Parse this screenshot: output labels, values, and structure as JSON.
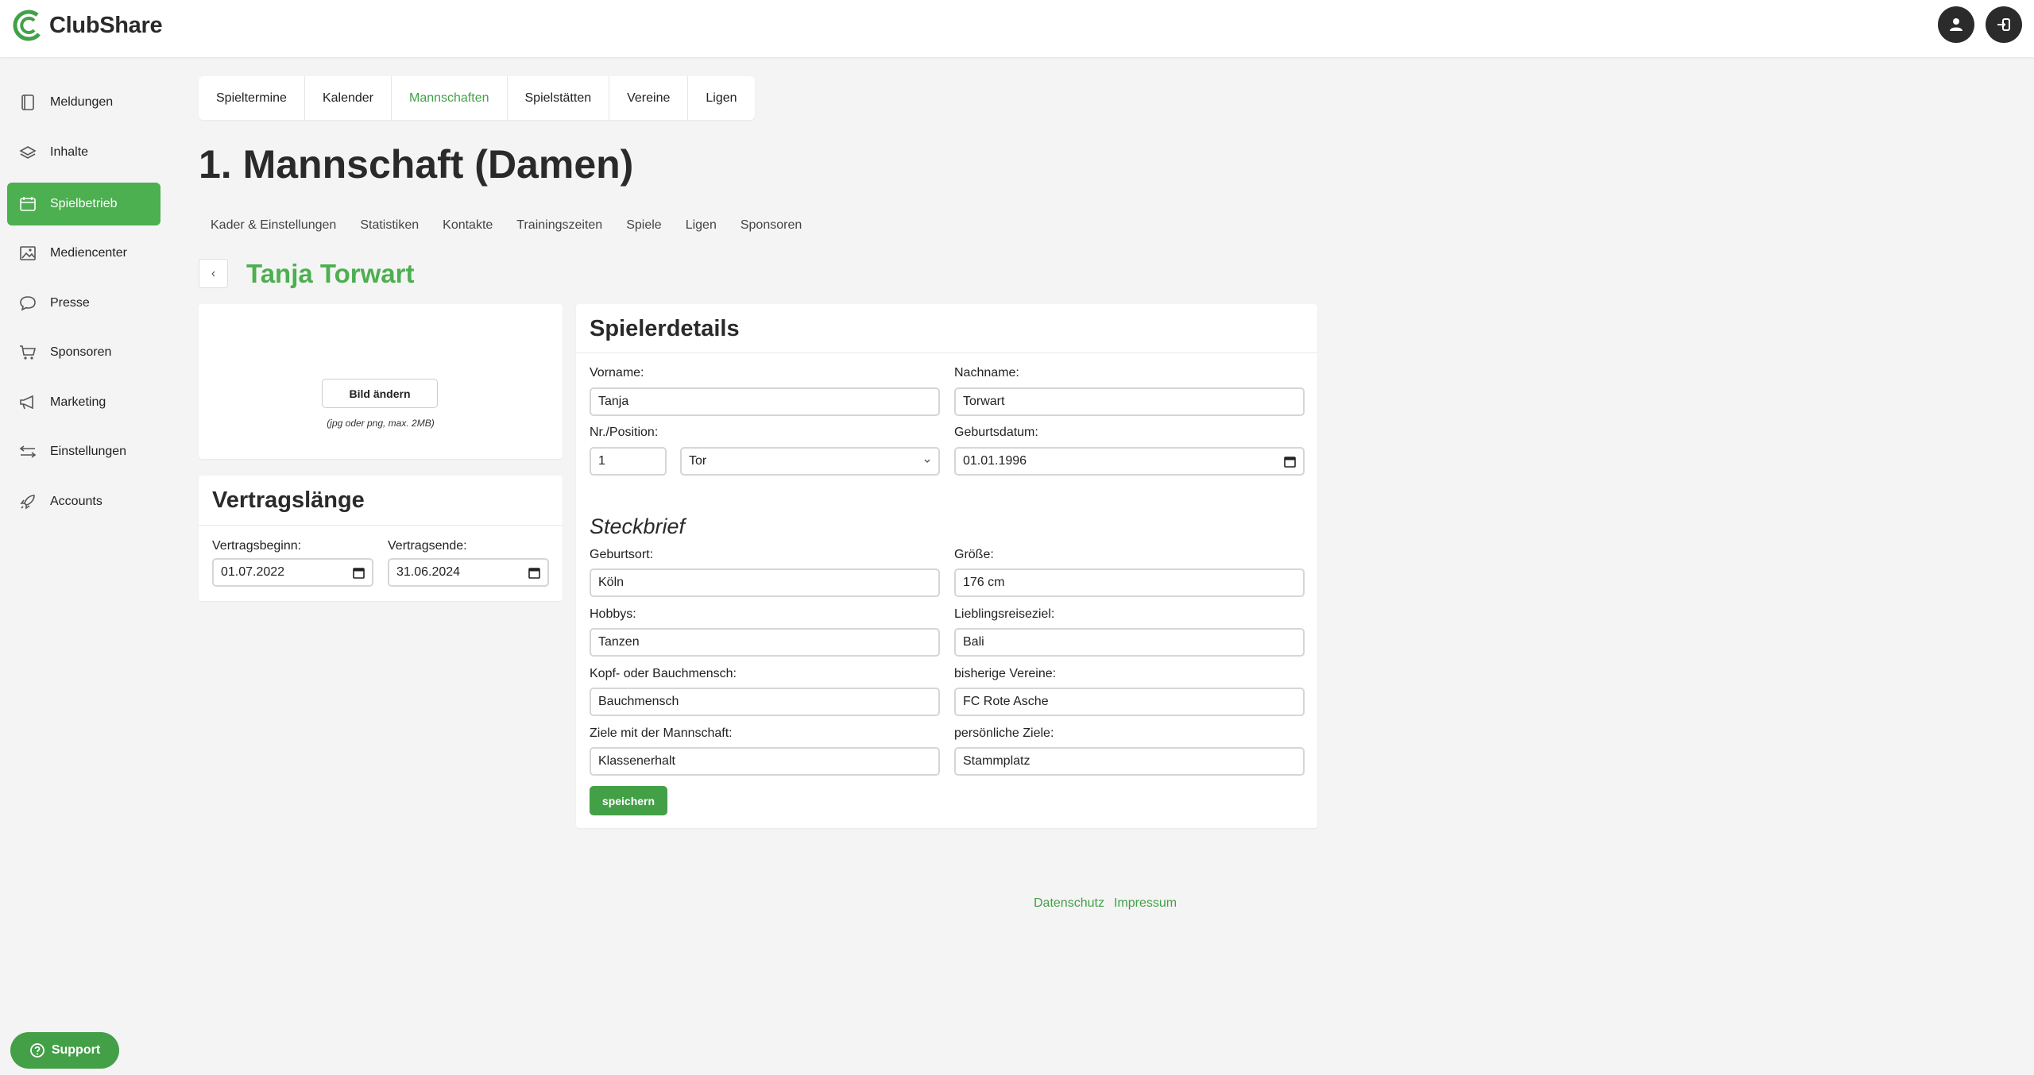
{
  "header": {
    "brand": "ClubShare"
  },
  "sidebar": {
    "items": [
      {
        "label": "Meldungen",
        "icon": "book-icon"
      },
      {
        "label": "Inhalte",
        "icon": "layers-icon"
      },
      {
        "label": "Spielbetrieb",
        "icon": "calendar-icon",
        "active": true
      },
      {
        "label": "Mediencenter",
        "icon": "image-icon"
      },
      {
        "label": "Presse",
        "icon": "chat-bubble-icon"
      },
      {
        "label": "Sponsoren",
        "icon": "cart-icon"
      },
      {
        "label": "Marketing",
        "icon": "megaphone-icon"
      },
      {
        "label": "Einstellungen",
        "icon": "sliders-icon"
      },
      {
        "label": "Accounts",
        "icon": "rocket-icon"
      }
    ],
    "support": "Support"
  },
  "tabs": [
    "Spieltermine",
    "Kalender",
    "Mannschaften",
    "Spielstätten",
    "Vereine",
    "Ligen"
  ],
  "active_tab": "Mannschaften",
  "page_title": "1. Mannschaft (Damen)",
  "subtabs": [
    "Kader & Einstellungen",
    "Statistiken",
    "Kontakte",
    "Trainingszeiten",
    "Spiele",
    "Ligen",
    "Sponsoren"
  ],
  "player_name": "Tanja Torwart",
  "image_card": {
    "button": "Bild ändern",
    "hint": "(jpg oder png, max. 2MB)"
  },
  "contract": {
    "title": "Vertragslänge",
    "start_label": "Vertragsbeginn:",
    "start_value": "01.07.2022",
    "end_label": "Vertragsende:",
    "end_value": "31.06.2024"
  },
  "details": {
    "title": "Spielerdetails",
    "vorname_label": "Vorname:",
    "vorname": "Tanja",
    "nachname_label": "Nachname:",
    "nachname": "Torwart",
    "nrpos_label": "Nr./Position:",
    "nr": "1",
    "position": "Tor",
    "geburtsdatum_label": "Geburtsdatum:",
    "geburtsdatum": "01.01.1996",
    "steckbrief_title": "Steckbrief",
    "geburtsort_label": "Geburtsort:",
    "geburtsort": "Köln",
    "groesse_label": "Größe:",
    "groesse": "176 cm",
    "hobbys_label": "Hobbys:",
    "hobbys": "Tanzen",
    "reiseziel_label": "Lieblingsreiseziel:",
    "reiseziel": "Bali",
    "kopf_label": "Kopf- oder Bauchmensch:",
    "kopf": "Bauchmensch",
    "vereine_label": "bisherige Vereine:",
    "vereine": "FC Rote Asche",
    "ziele_mannschaft_label": "Ziele mit der Mannschaft:",
    "ziele_mannschaft": "Klassenerhalt",
    "ziele_persoenlich_label": "persönliche Ziele:",
    "ziele_persoenlich": "Stammplatz",
    "save": "speichern"
  },
  "footer": {
    "datenschutz": "Datenschutz",
    "impressum": "Impressum"
  },
  "colors": {
    "accent": "#43a047",
    "active_nav": "#4caf50",
    "header_button": "#2b2b2b"
  }
}
